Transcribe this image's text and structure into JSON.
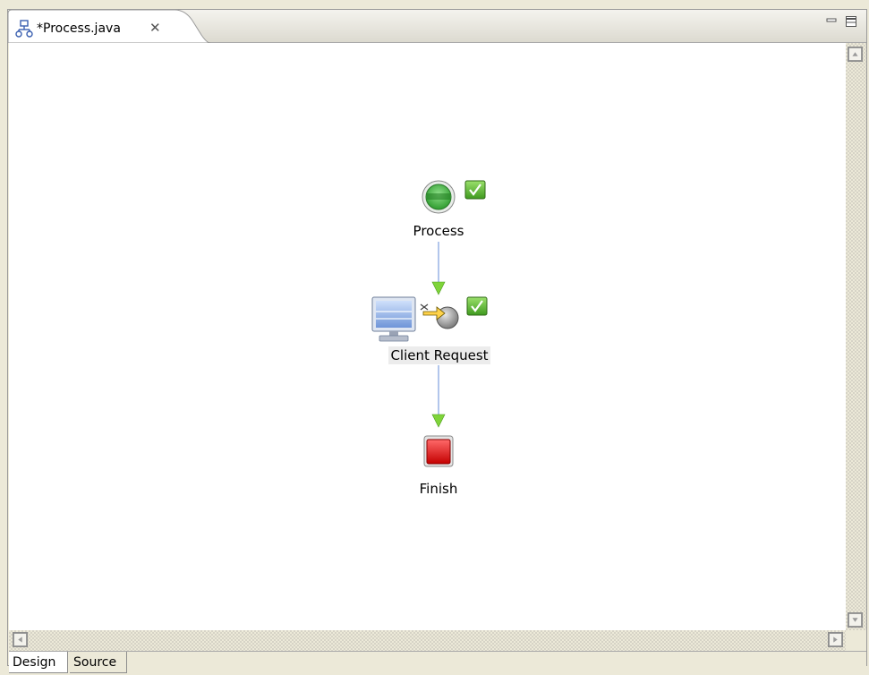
{
  "editor": {
    "tab_title": "*Process.java",
    "tab_icon": "process-diagram-icon",
    "close_icon": "close-icon",
    "minimize_icon": "minimize-icon",
    "maximize_icon": "maximize-icon"
  },
  "diagram": {
    "nodes": [
      {
        "id": "process",
        "label": "Process",
        "icon": "start-node-icon",
        "status_icon": "checkmark-icon"
      },
      {
        "id": "client-request",
        "label": "Client Request",
        "icon": "computer-icon",
        "secondary_icon": "web-service-icon",
        "status_icon": "checkmark-icon"
      },
      {
        "id": "finish",
        "label": "Finish",
        "icon": "stop-node-icon"
      }
    ],
    "connections": [
      {
        "from": "Process",
        "to": "Client Request"
      },
      {
        "from": "Client Request",
        "to": "Finish"
      }
    ],
    "colors": {
      "connector": "#7f9fe0",
      "arrowhead": "#7fd43a",
      "start": "#3eae3e",
      "stop": "#d61010",
      "check": "#4fae2a"
    }
  },
  "bottom_tabs": {
    "design": "Design",
    "source": "Source",
    "selected": "Design"
  }
}
